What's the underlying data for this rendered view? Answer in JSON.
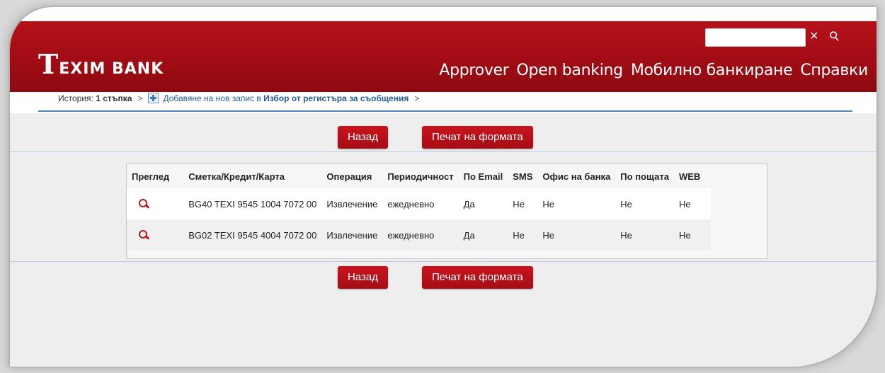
{
  "brand": {
    "logo_first": "T",
    "logo_rest": "EXIM BANK"
  },
  "search": {
    "placeholder": "",
    "clear_icon": "×",
    "search_icon": "⚲"
  },
  "nav": [
    "Approver",
    "Open banking",
    "Мобилно банкиране",
    "Справки"
  ],
  "breadcrumb": {
    "prefix": "История:",
    "steps": "1 стъпка",
    "separator": ">",
    "link_text": "Добавяне на нов запис в",
    "link_bold": "Избор от регистъра за съобщения"
  },
  "buttons": {
    "back": "Назад",
    "print": "Печат на формата"
  },
  "table": {
    "headers": [
      "Преглед",
      "Сметка/Кредит/Карта",
      "Операция",
      "Периодичност",
      "По Email",
      "SMS",
      "Офис на банка",
      "По пощата",
      "WEB"
    ],
    "rows": [
      [
        "",
        "BG40 TEXI 9545 1004 7072 00",
        "Извлечение",
        "ежедневно",
        "Да",
        "Не",
        "Не",
        "Не",
        "Не"
      ],
      [
        "",
        "BG02 TEXI 9545 4004 7072 00",
        "Извлечение",
        "ежедневно",
        "Да",
        "Не",
        "Не",
        "Не",
        "Не"
      ]
    ]
  },
  "colors": {
    "brand_red": "#a10c14",
    "link_blue": "#1d5b9b"
  }
}
